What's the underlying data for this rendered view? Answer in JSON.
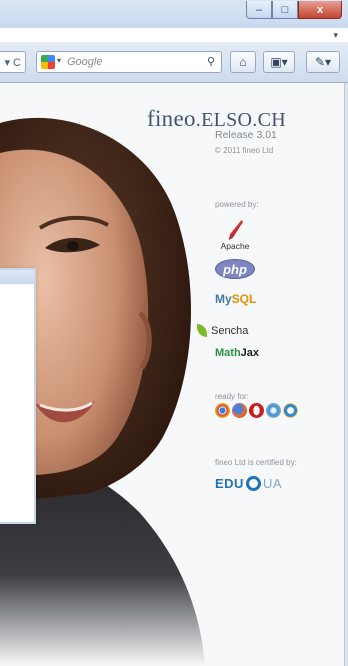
{
  "window": {
    "controls": {
      "minimize": "–",
      "maximize": "□",
      "close": "x"
    },
    "tab_list_chevron": "▾"
  },
  "toolbar": {
    "url_tail": "▾ C",
    "search": {
      "engine_dropdown": "▾",
      "placeholder": "Google",
      "search_glyph": "⚲"
    },
    "home_glyph": "⌂",
    "bookmark_glyph": "▣▾",
    "extension_glyph": "✎▾"
  },
  "brand": {
    "name": "fineo",
    "suffix": ".ELSO.CH",
    "release": "Release 3.01",
    "copyright": "© 2011 fineo Ltd"
  },
  "powered_by": {
    "heading": "powered by:",
    "apache": "Apache",
    "php": "php",
    "mysql_my": "My",
    "mysql_sql": "SQL",
    "sencha": "Sencha",
    "mathjax_math": "Math",
    "mathjax_jax": "Jax"
  },
  "ready_for": {
    "heading": "ready for:",
    "browsers": [
      {
        "icon": "chrome-icon",
        "color": "#e2b325"
      },
      {
        "icon": "firefox-icon",
        "color": "#d9612b"
      },
      {
        "icon": "opera-icon",
        "color": "#cc1b1b"
      },
      {
        "icon": "safari-icon",
        "color": "#3c8fd1"
      },
      {
        "icon": "ie-icon",
        "color": "#2d8ad3"
      }
    ]
  },
  "certified": {
    "heading": "fineo Ltd is certified by:",
    "edu": "EDU",
    "ua": "UA"
  }
}
